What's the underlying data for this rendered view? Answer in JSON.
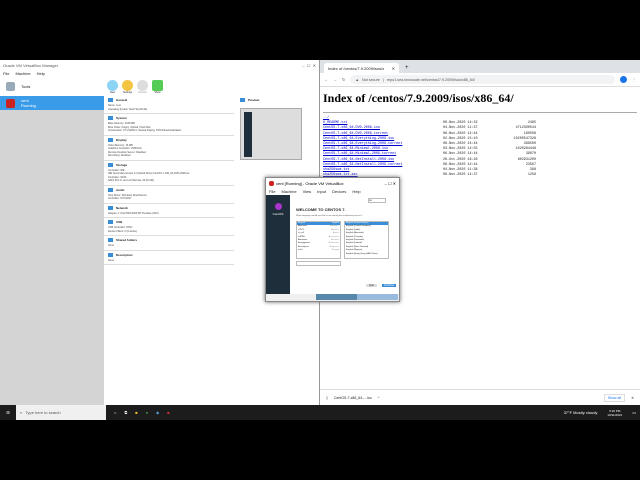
{
  "vbox": {
    "title": "Oracle VM VirtualBox Manager",
    "menu": [
      "File",
      "Machine",
      "Help"
    ],
    "tools": "Tools",
    "vm_name": "cent",
    "vm_state": "Running",
    "toolbar": [
      "New",
      "Settings",
      "Discard",
      "Show"
    ],
    "sections": [
      {
        "title": "General",
        "lines": [
          "Name: cent",
          "Operating System: Red Hat (64-bit)"
        ]
      },
      {
        "title": "System",
        "lines": [
          "Base Memory: 2048 MB",
          "Boot Order: Floppy, Optical, Hard Disk",
          "Acceleration: VT-x/AMD-V, Nested Paging, KVM Paravirtualization"
        ]
      },
      {
        "title": "Display",
        "lines": [
          "Video Memory: 16 MB",
          "Graphics Controller: VMSVGA",
          "Remote Desktop Server: Disabled",
          "Recording: Disabled"
        ]
      },
      {
        "title": "Storage",
        "lines": [
          "Controller: IDE",
          "IDE Secondary Device 0: [Optical Drive] CentOS-7-x86_64-DVD-2009.iso",
          "Controller: SATA",
          "SATA Port 0: cent.vdi (Normal, 20.00 GB)"
        ]
      },
      {
        "title": "Audio",
        "lines": [
          "Host Driver: Windows DirectSound",
          "Controller: ICH AC97"
        ]
      },
      {
        "title": "Network",
        "lines": [
          "Adapter 1: Intel PRO/1000 MT Desktop (NAT)"
        ]
      },
      {
        "title": "USB",
        "lines": [
          "USB Controller: OHCI",
          "Device Filters: 0 (0 active)"
        ]
      },
      {
        "title": "Shared folders",
        "lines": [
          "None"
        ]
      },
      {
        "title": "Description",
        "lines": [
          "None"
        ]
      }
    ],
    "preview": "Preview"
  },
  "chrome": {
    "tab_title": "Index of /centos/7.9.2009/isos/x",
    "not_secure": "Not secure",
    "url": "repo1.sea.innoscale.net/centos/7.9.2009/isos/x86_64/",
    "heading": "Index of /centos/7.9.2009/isos/x86_64/",
    "parent": "../",
    "files": [
      [
        "0_README.txt",
        "06-Nov-2020 14:32",
        "2495"
      ],
      [
        "CentOS-7-x86_64-DVD-2009.iso",
        "04-Nov-2020 11:37",
        "4712300544"
      ],
      [
        "CentOS-7-x86_64-DVD-2009.torrent",
        "06-Nov-2020 14:44",
        "180508"
      ],
      [
        "CentOS-7-x86_64-Everything-2009.iso",
        "02-Nov-2020 15:10",
        "10200547328"
      ],
      [
        "CentOS-7-x86_64-Everything-2009.torrent",
        "06-Nov-2020 14:44",
        "389500"
      ],
      [
        "CentOS-7-x86_64-Minimal-2009.iso",
        "03-Nov-2020 14:55",
        "1020264448"
      ],
      [
        "CentOS-7-x86_64-Minimal-2009.torrent",
        "06-Nov-2020 14:44",
        "39070"
      ],
      [
        "CentOS-7-x86_64-NetInstall-2009.iso",
        "26-Oct-2020 16:26",
        "602931200"
      ],
      [
        "CentOS-7-x86_64-NetInstall-2009.torrent",
        "06-Nov-2020 14:44",
        "23567"
      ],
      [
        "sha256sum.txt",
        "04-Nov-2020 11:38",
        "398"
      ],
      [
        "sha256sum.txt.asc",
        "06-Nov-2020 14:37",
        "1258"
      ]
    ],
    "download": "CentOS-7-x86_64-....iso",
    "show_all": "Show all"
  },
  "vm": {
    "title": "cent [Running] - Oracle VM VirtualBox",
    "menu": [
      "File",
      "Machine",
      "View",
      "Input",
      "Devices",
      "Help"
    ],
    "brand": "CentOS",
    "welcome": "WELCOME TO CENTOS 7.",
    "question": "What language would you like to use during the installation process?",
    "keyboard": "us",
    "languages": [
      [
        "English",
        "English"
      ],
      [
        "Afrikaans",
        "Afrikaans"
      ],
      [
        "አማርኛ",
        "Amharic"
      ],
      [
        "العربية",
        "Arabic"
      ],
      [
        "অসমীয়া",
        "Assamese"
      ],
      [
        "Asturianu",
        "Asturian"
      ],
      [
        "Беларуская",
        "Belarusian"
      ],
      [
        "Български",
        "Bulgarian"
      ],
      [
        "বাংলা",
        "Bengali"
      ]
    ],
    "locales": [
      "English (United States)",
      "English (United Kingdom)",
      "English (India)",
      "English (Australia)",
      "English (Canada)",
      "English (Denmark)",
      "English (Ireland)",
      "English (New Zealand)",
      "English (Nigeria)",
      "English (Hong Kong SAR China)"
    ],
    "quit": "Quit",
    "continue": "Continue"
  },
  "taskbar": {
    "search": "Type here to search",
    "weather": "37°F Mostly cloudy",
    "time": "5:32 PM",
    "date": "10/11/2021"
  }
}
